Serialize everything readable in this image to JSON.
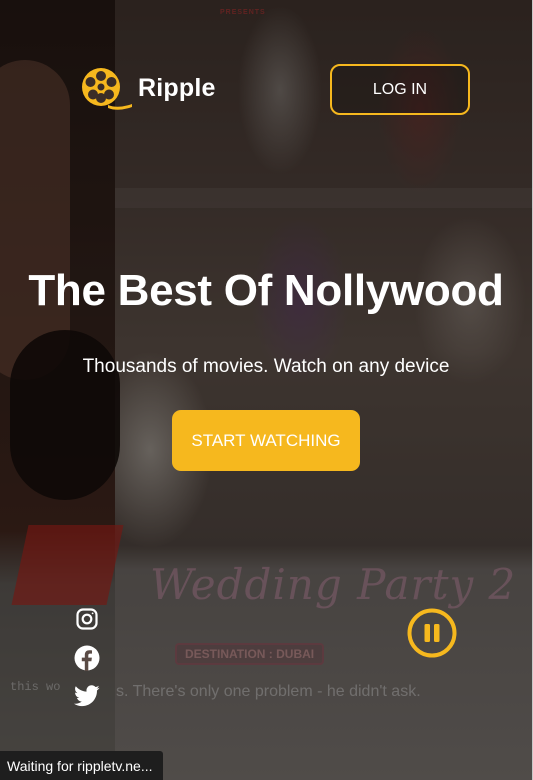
{
  "brand": {
    "name": "Ripple",
    "accent_color": "#f6b81e",
    "logo_icon": "film-reel-icon"
  },
  "header": {
    "login_label": "LOG IN"
  },
  "hero": {
    "title": "The Best Of Nollywood",
    "subtitle": "Thousands of movies. Watch on any device",
    "cta_label": "START WATCHING"
  },
  "poster": {
    "top_text": "PRESENTS",
    "film_title": "Wedding Party 2",
    "badge": "DESTINATION : DUBAI",
    "tagline_left": "this wo",
    "tagline": "s. There's only one problem - he didn't ask."
  },
  "social": [
    {
      "name": "instagram",
      "icon": "instagram-icon"
    },
    {
      "name": "facebook",
      "icon": "facebook-icon"
    },
    {
      "name": "twitter",
      "icon": "twitter-icon"
    }
  ],
  "player": {
    "control": "pause-icon"
  },
  "browser_status": {
    "text": "Waiting for rippletv.ne..."
  }
}
